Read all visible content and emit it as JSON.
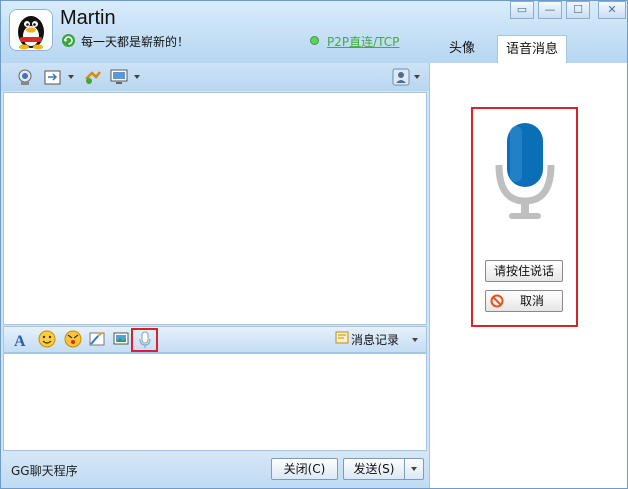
{
  "window": {
    "name": "Martin",
    "signature": "每一天都是崭新的！",
    "connection": "P2P直连/TCP",
    "controls": [
      "▭",
      "—",
      "☐",
      "✕"
    ]
  },
  "tabs": [
    {
      "label": "头像",
      "active": false
    },
    {
      "label": "语音消息",
      "active": true
    }
  ],
  "toolbar": {
    "icons": [
      "video-call-icon",
      "file-transfer-icon",
      "remote-assist-icon",
      "screen-share-icon",
      "user-settings-icon"
    ]
  },
  "input_toolbar": {
    "icons": [
      "font-icon",
      "emoji-icon",
      "shake-icon",
      "screenshot-icon",
      "picture-icon",
      "voice-message-icon"
    ],
    "history_label": "消息记录"
  },
  "footer": {
    "program_name": "GG聊天程序",
    "close_label": "关闭(C)",
    "send_label": "发送(S)"
  },
  "voice_panel": {
    "hold_to_talk_label": "请按住说话",
    "cancel_label": "取消"
  },
  "colors": {
    "accent_red": "#d9232c",
    "mic_blue": "#0b6fb8",
    "connected_green": "#44aa44"
  }
}
